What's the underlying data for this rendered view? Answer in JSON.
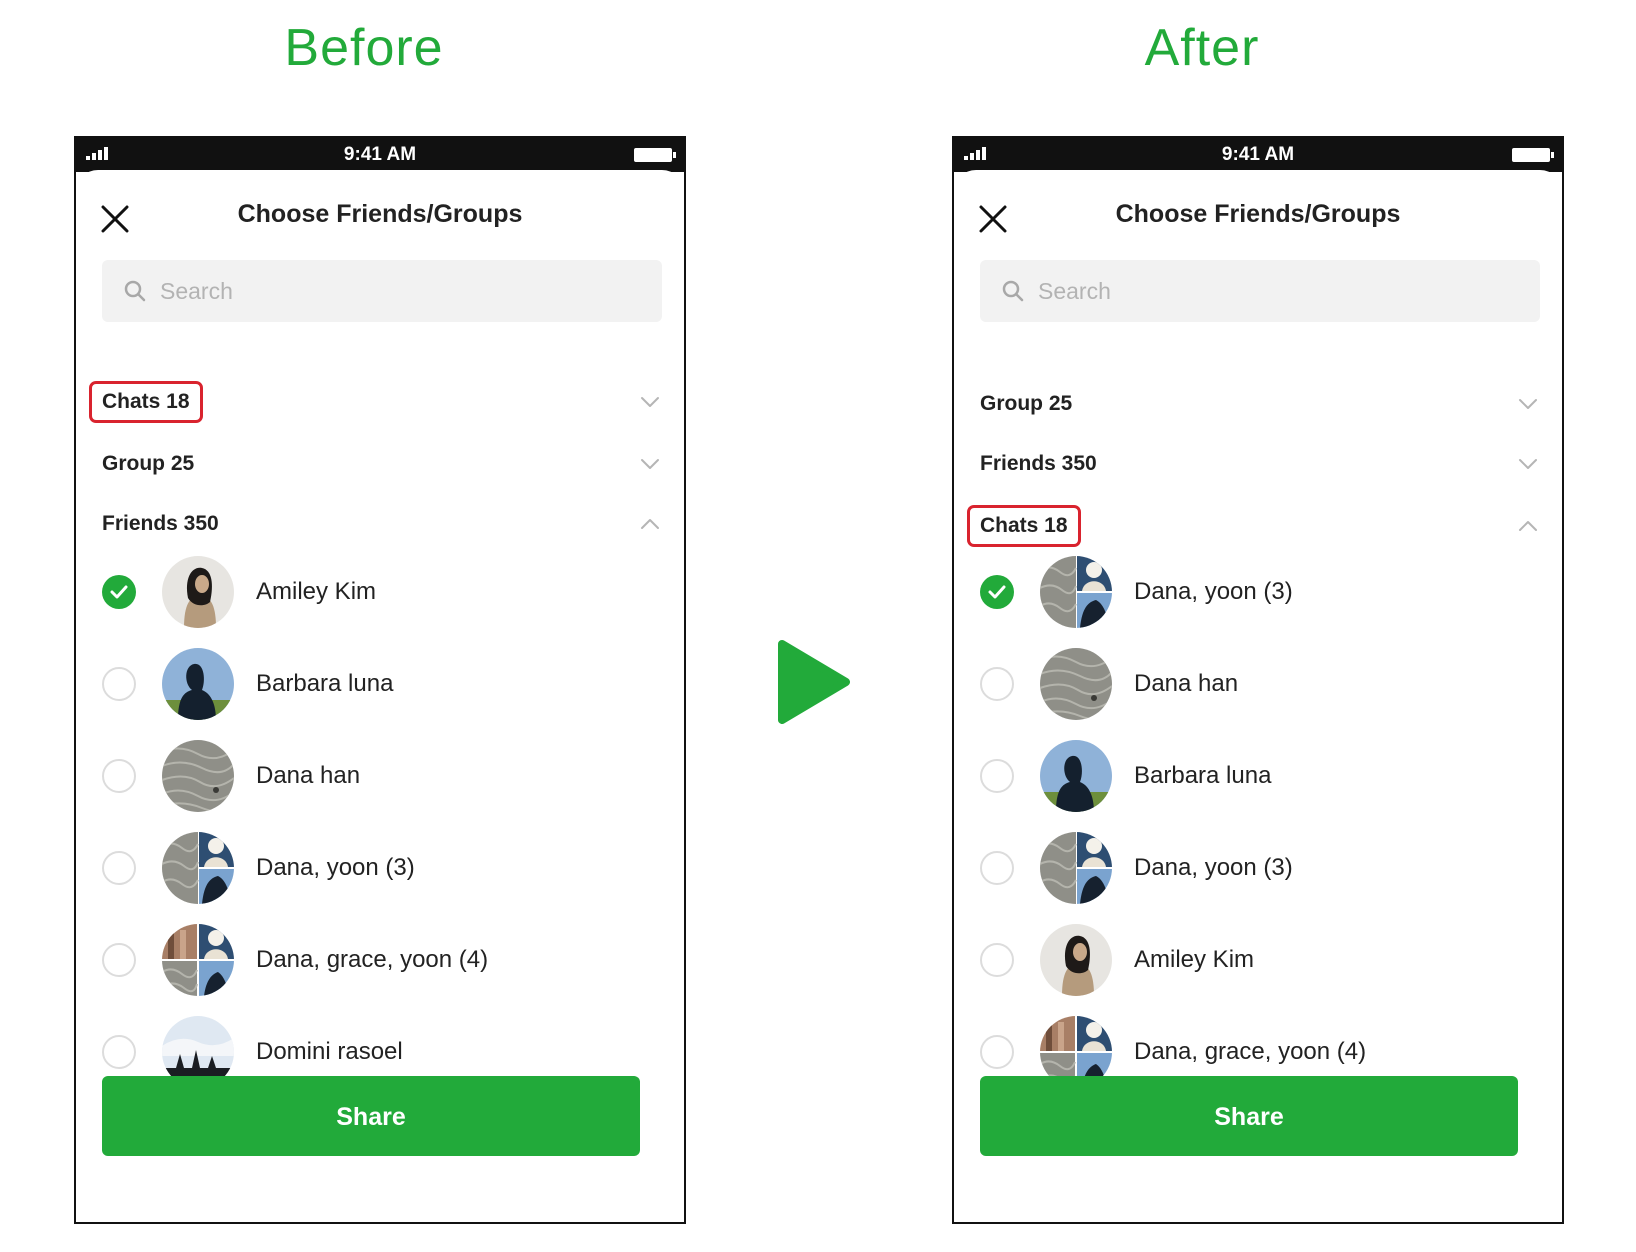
{
  "labels": {
    "before": "Before",
    "after": "After"
  },
  "colors": {
    "accent": "#22aa3a",
    "highlight": "#d9232e"
  },
  "before": {
    "status_time": "9:41 AM",
    "title": "Choose Friends/Groups",
    "search_placeholder": "Search",
    "sections": [
      {
        "label": "Chats 18",
        "expanded": false,
        "highlighted": true
      },
      {
        "label": "Group 25",
        "expanded": false,
        "highlighted": false
      },
      {
        "label": "Friends 350",
        "expanded": true,
        "highlighted": false
      }
    ],
    "rows": [
      {
        "name": "Amiley Kim",
        "checked": true,
        "avatar": "person-dark-hair"
      },
      {
        "name": "Barbara luna",
        "checked": false,
        "avatar": "person-silhouette-sky"
      },
      {
        "name": "Dana han",
        "checked": false,
        "avatar": "gray-texture"
      },
      {
        "name": "Dana, yoon (3)",
        "checked": false,
        "avatar": "group-split-2"
      },
      {
        "name": "Dana, grace, yoon (4)",
        "checked": false,
        "avatar": "group-split-4"
      },
      {
        "name": "Domini rasoel",
        "checked": false,
        "avatar": "landscape-sky"
      }
    ],
    "share_label": "Share"
  },
  "after": {
    "status_time": "9:41 AM",
    "title": "Choose Friends/Groups",
    "search_placeholder": "Search",
    "sections": [
      {
        "label": "Group 25",
        "expanded": false,
        "highlighted": false
      },
      {
        "label": "Friends 350",
        "expanded": false,
        "highlighted": false
      },
      {
        "label": "Chats 18",
        "expanded": true,
        "highlighted": true
      }
    ],
    "rows": [
      {
        "name": "Dana, yoon (3)",
        "checked": true,
        "avatar": "group-split-2"
      },
      {
        "name": "Dana han",
        "checked": false,
        "avatar": "gray-texture"
      },
      {
        "name": "Barbara luna",
        "checked": false,
        "avatar": "person-silhouette-sky"
      },
      {
        "name": "Dana, yoon (3)",
        "checked": false,
        "avatar": "group-split-2"
      },
      {
        "name": "Amiley Kim",
        "checked": false,
        "avatar": "person-dark-hair"
      },
      {
        "name": "Dana, grace, yoon (4)",
        "checked": false,
        "avatar": "group-split-4"
      }
    ],
    "share_label": "Share"
  }
}
